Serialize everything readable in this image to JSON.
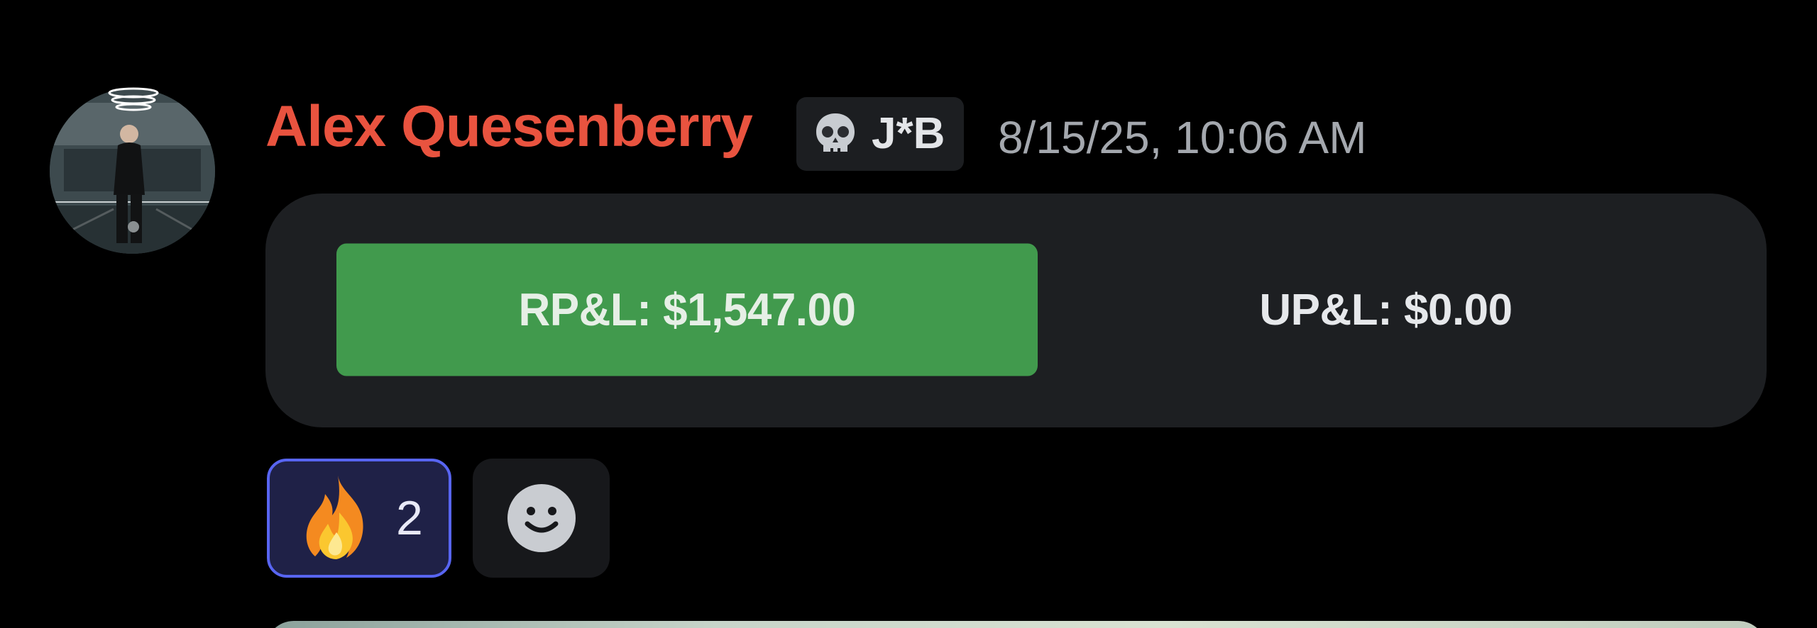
{
  "message": {
    "author": {
      "name": "Alex Quesenberry",
      "name_color": "#e9533f",
      "avatar_icon": "user-avatar-photo"
    },
    "role_tag": {
      "icon": "skull-icon",
      "text": "J*B"
    },
    "timestamp": "8/15/25, 10:06 AM",
    "embed": {
      "buttons": [
        {
          "label": "RP&L: $1,547.00",
          "style": "success",
          "color": "#419a4d"
        },
        {
          "label": "UP&L: $0.00",
          "style": "plain"
        }
      ]
    },
    "reactions": [
      {
        "emoji": "fire-icon",
        "count": "2",
        "selected": true,
        "accent": "#5865f2"
      }
    ],
    "add_reaction": {
      "icon": "add-reaction-smile-icon"
    }
  }
}
